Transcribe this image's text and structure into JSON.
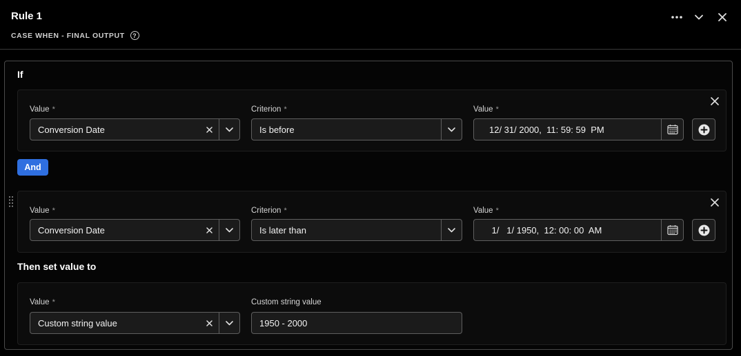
{
  "header": {
    "title": "Rule 1",
    "subtitle": "CASE WHEN - FINAL OUTPUT",
    "help_icon": "?"
  },
  "if_section": {
    "title": "If",
    "conditions": [
      {
        "value_label": "Value",
        "value": "Conversion Date",
        "criterion_label": "Criterion",
        "criterion": "Is before",
        "date_label": "Value",
        "date": "12/ 31/ 2000,  11: 59: 59  PM"
      },
      {
        "value_label": "Value",
        "value": "Conversion Date",
        "criterion_label": "Criterion",
        "criterion": "Is later than",
        "date_label": "Value",
        "date": " 1/   1/ 1950,  12: 00: 00  AM"
      }
    ],
    "and_label": "And",
    "required_mark": "*"
  },
  "then_section": {
    "title": "Then set value to",
    "value_label": "Value",
    "value": "Custom string value",
    "custom_label": "Custom string value",
    "custom_value": "1950 - 2000"
  },
  "icons": [
    "more-icon",
    "chevron-down-icon",
    "close-icon",
    "help-icon",
    "clear-icon",
    "calendar-icon",
    "add-circle-icon",
    "drag-handle-icon"
  ],
  "colors": {
    "accent": "#2f6fe0",
    "background": "#000000",
    "field": "#1b1b1b",
    "border": "#5f5f5f"
  }
}
